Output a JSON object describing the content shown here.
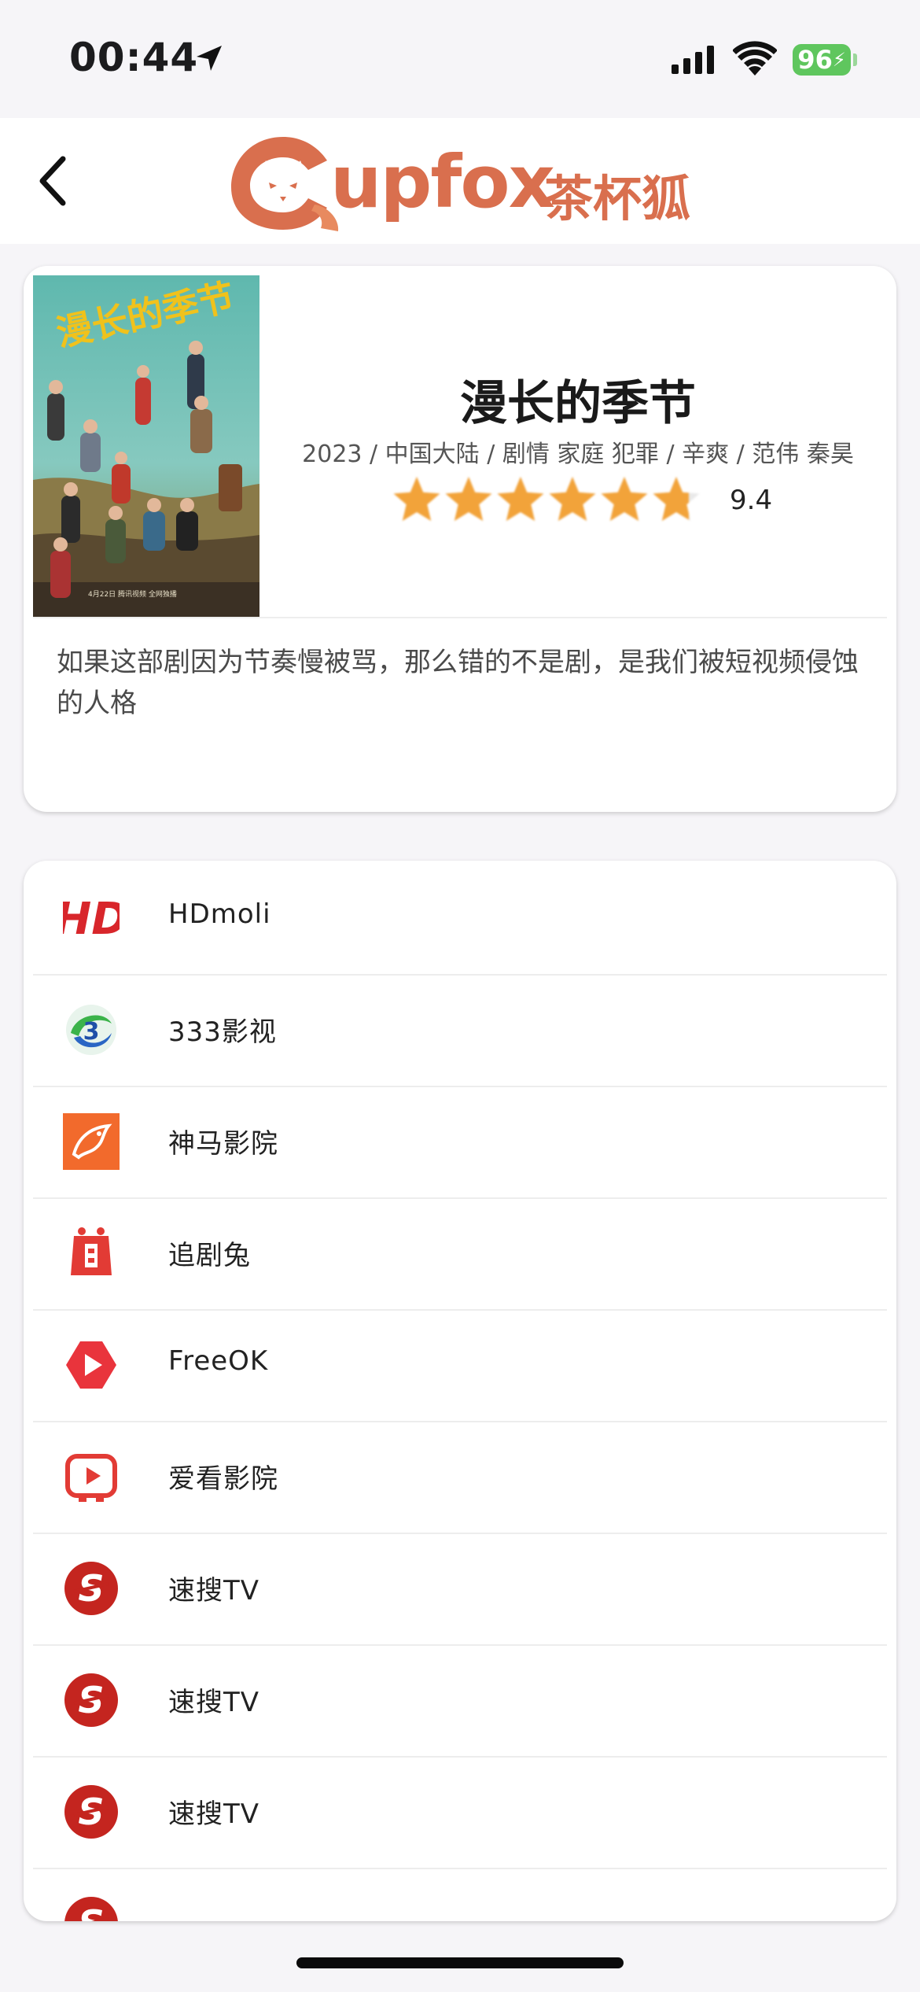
{
  "status_bar": {
    "time": "00:44",
    "battery": "96"
  },
  "nav": {
    "logo_text": "upfox",
    "logo_cn": "茶杯狐"
  },
  "movie": {
    "title": "漫长的季节",
    "meta": "2023 / 中国大陆 / 剧情 家庭 犯罪 / 辛爽 / 范伟 秦昊",
    "rating": "9.4",
    "rating_fraction": 0.94,
    "description": "如果这部剧因为节奏慢被骂，那么错的不是剧，是我们被短视频侵蚀的人格",
    "poster_caption": "漫长的季节"
  },
  "sources": [
    {
      "name": "HDmoli",
      "icon": "hdmoli-icon"
    },
    {
      "name": "333影视",
      "icon": "333-icon"
    },
    {
      "name": "神马影院",
      "icon": "shenma-icon"
    },
    {
      "name": "追剧兔",
      "icon": "zhuijutu-icon"
    },
    {
      "name": "FreeOK",
      "icon": "freeok-icon"
    },
    {
      "name": "爱看影院",
      "icon": "aikan-icon"
    },
    {
      "name": "速搜TV",
      "icon": "susou-icon"
    },
    {
      "name": "速搜TV",
      "icon": "susou-icon"
    },
    {
      "name": "速搜TV",
      "icon": "susou-icon"
    }
  ],
  "colors": {
    "brand": "#d96f4e",
    "accent_red": "#e23b35",
    "star": "#f2a33a"
  }
}
